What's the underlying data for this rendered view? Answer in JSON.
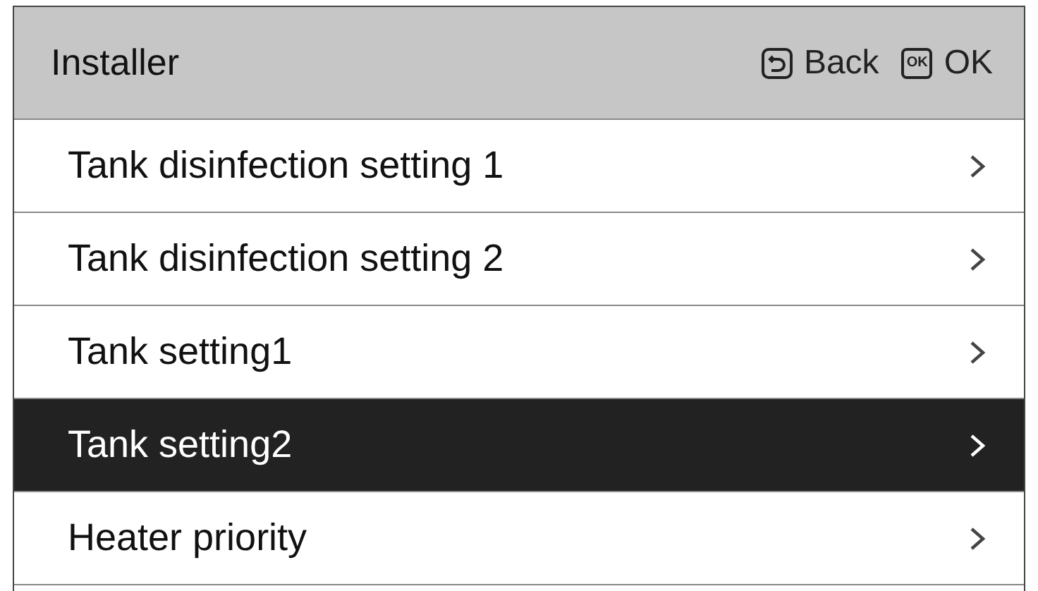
{
  "header": {
    "title": "Installer",
    "actions": [
      {
        "kind": "back",
        "label": "Back"
      },
      {
        "kind": "ok",
        "icon_label": "OK",
        "label": "OK"
      }
    ]
  },
  "menu": [
    {
      "label": "Tank disinfection setting 1",
      "selected": false
    },
    {
      "label": "Tank disinfection setting 2",
      "selected": false
    },
    {
      "label": "Tank setting1",
      "selected": false
    },
    {
      "label": "Tank setting2",
      "selected": true
    },
    {
      "label": "Heater priority",
      "selected": false
    }
  ]
}
